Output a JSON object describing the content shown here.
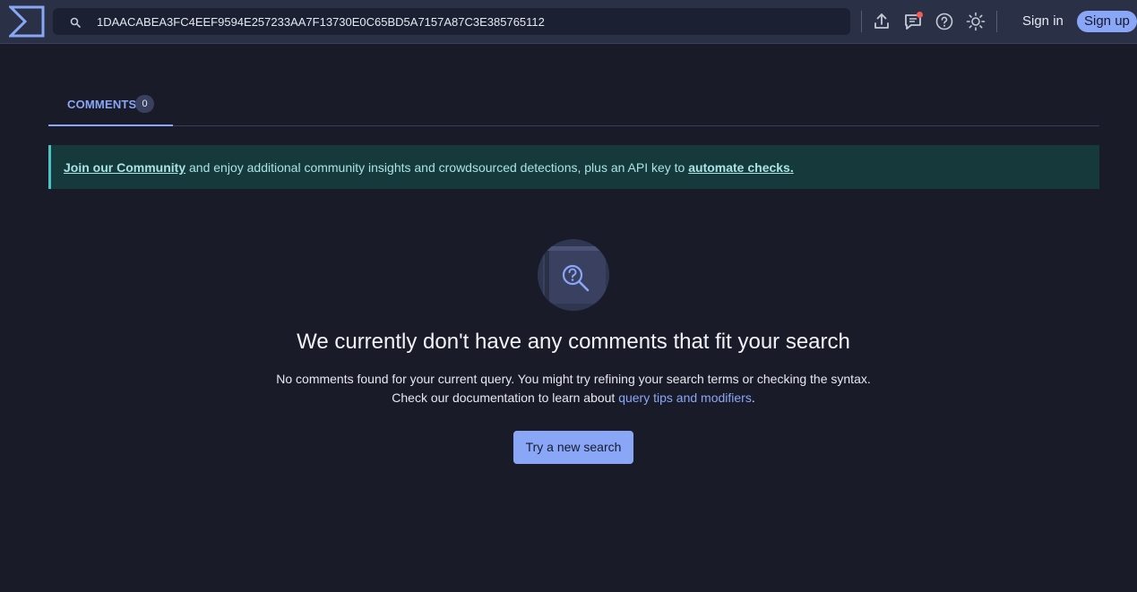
{
  "header": {
    "logo_icon": "sigma-logo-icon",
    "search": {
      "value": "1DAACABEA3FC4EEF9594E257233AA7F13730E0C65BD5A7157A87C3E385765112",
      "icon": "search-icon"
    },
    "icons": [
      "upload-icon",
      "chat-icon",
      "help-icon",
      "theme-toggle-icon"
    ],
    "sign_in": "Sign in",
    "sign_up": "Sign up"
  },
  "tabs": [
    {
      "label": "COMMENTS",
      "count": "0",
      "active": true
    }
  ],
  "banner": {
    "link1": "Join our Community",
    "middle": " and enjoy additional community insights and crowdsourced detections, plus an API key to ",
    "link2": "automate checks."
  },
  "empty_state": {
    "icon": "search-question-icon",
    "title": "We currently don't have any comments that fit your search",
    "line1": "No comments found for your current query. You might try refining your search terms or checking the syntax.",
    "line2_prefix": "Check our documentation to learn about ",
    "line2_link": "query tips and modifiers",
    "line2_suffix": ".",
    "button": "Try a new search"
  },
  "colors": {
    "accent": "#8aa7f7",
    "header_bg": "#2a3147",
    "page_bg": "#1a1b28",
    "banner_bg": "#163a3c",
    "banner_border": "#4cc2c2",
    "notification_dot": "#f25c54"
  }
}
